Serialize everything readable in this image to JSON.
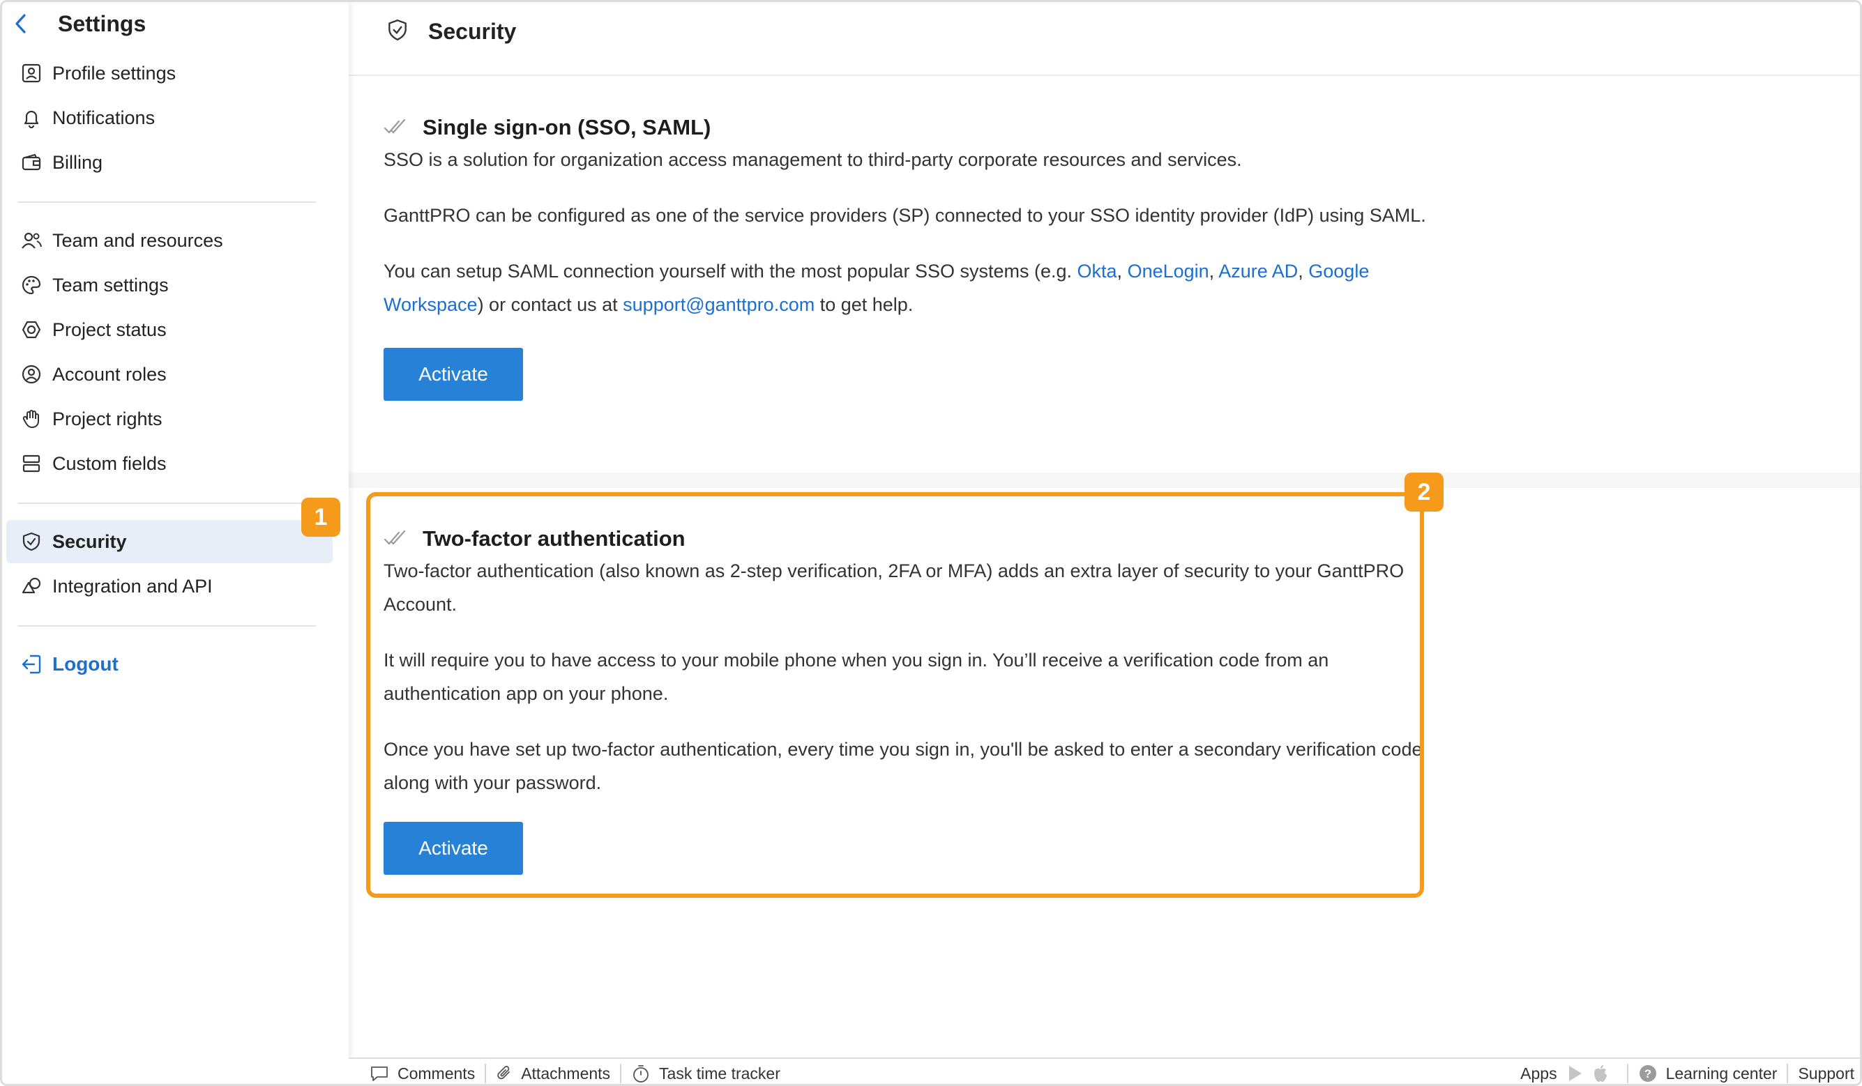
{
  "sidebar": {
    "title": "Settings",
    "group1": [
      {
        "label": "Profile settings",
        "icon": "profile-icon"
      },
      {
        "label": "Notifications",
        "icon": "bell-icon"
      },
      {
        "label": "Billing",
        "icon": "wallet-icon"
      }
    ],
    "group2": [
      {
        "label": "Team and resources",
        "icon": "team-icon"
      },
      {
        "label": "Team settings",
        "icon": "palette-icon"
      },
      {
        "label": "Project status",
        "icon": "status-icon"
      },
      {
        "label": "Account roles",
        "icon": "user-circle-icon"
      },
      {
        "label": "Project rights",
        "icon": "hand-icon"
      },
      {
        "label": "Custom fields",
        "icon": "fields-icon"
      }
    ],
    "group3": [
      {
        "label": "Security",
        "icon": "shield-icon",
        "active": true
      },
      {
        "label": "Integration and API",
        "icon": "shapes-icon"
      }
    ],
    "logout": "Logout"
  },
  "badges": {
    "one": "1",
    "two": "2"
  },
  "header": {
    "title": "Security"
  },
  "sso": {
    "title": "Single sign-on (SSO, SAML)",
    "p1": "SSO is a solution for organization access management to third-party corporate resources and services.",
    "p2": "GanttPRO can be configured as one of the service providers (SP) connected to your SSO identity provider (IdP) using SAML.",
    "p3_a": "You can setup SAML connection yourself with the most popular SSO systems (e.g. ",
    "okta": "Okta",
    "onelogin": "OneLogin",
    "azure": "Azure AD",
    "google": "Google Workspace",
    "p3_b": ") or contact us at ",
    "email": "support@ganttpro.com",
    "p3_c": " to get help.",
    "comma": ", ",
    "button": "Activate"
  },
  "tfa": {
    "title": "Two-factor authentication",
    "p1": "Two-factor authentication (also known as 2-step verification, 2FA or MFA) adds an extra layer of security to your GanttPRO Account.",
    "p2": "It will require you to have access to your mobile phone when you sign in. You’ll receive a verification code from an authentication app on your phone.",
    "p3": "Once you have set up two-factor authentication, every time you sign in, you'll be asked to enter a secondary verification code along with your password.",
    "button": "Activate"
  },
  "footer": {
    "comments": "Comments",
    "attachments": "Attachments",
    "tracker": "Task time tracker",
    "apps": "Apps",
    "learning": "Learning center",
    "support": "Support"
  },
  "colors": {
    "accent": "#2781d6",
    "link": "#1a6fd0",
    "highlight": "#f59a1b",
    "active_bg": "#e8eef8"
  }
}
